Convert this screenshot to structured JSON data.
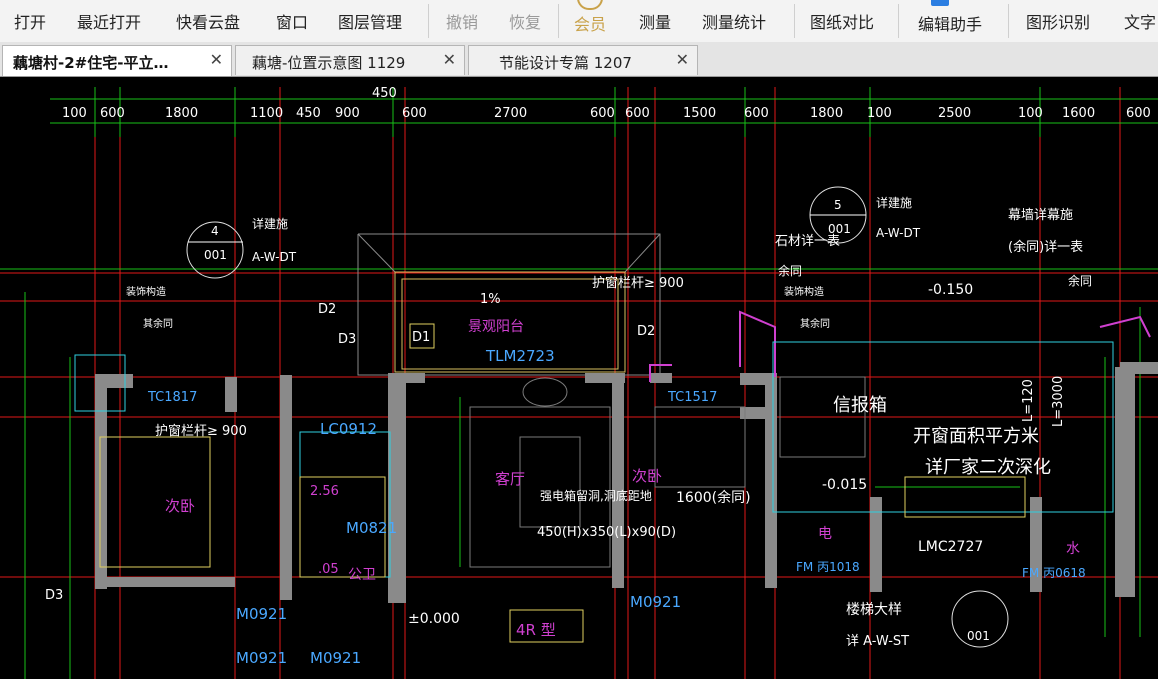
{
  "toolbar": {
    "items": [
      {
        "label": "打开",
        "state": "enabled"
      },
      {
        "label": "最近打开",
        "state": "enabled"
      },
      {
        "label": "快看云盘",
        "state": "enabled"
      },
      {
        "label": "窗口",
        "state": "enabled"
      },
      {
        "label": "图层管理",
        "state": "enabled"
      },
      {
        "label": "撤销",
        "state": "disabled"
      },
      {
        "label": "恢复",
        "state": "disabled"
      },
      {
        "label": "会员",
        "state": "vip"
      },
      {
        "label": "测量",
        "state": "enabled"
      },
      {
        "label": "测量统计",
        "state": "enabled"
      },
      {
        "label": "图纸对比",
        "state": "enabled"
      },
      {
        "label": "编辑助手",
        "state": "enabled"
      },
      {
        "label": "图形识别",
        "state": "enabled"
      },
      {
        "label": "文字",
        "state": "enabled"
      }
    ]
  },
  "tabs": [
    {
      "label": "藕塘村-2#住宅-平立…",
      "active": true,
      "close": "✕"
    },
    {
      "label": "藕塘-位置示意图 1129",
      "active": false,
      "close": "✕"
    },
    {
      "label": "节能设计专篇 1207",
      "active": false,
      "close": "✕"
    }
  ],
  "drawing": {
    "top_dim_labels": [
      "100",
      "600",
      "1800",
      "1100",
      "450",
      "900",
      "600",
      "2700",
      "600",
      "600",
      "1500",
      "600",
      "1800",
      "100",
      "2500",
      "100",
      "1600",
      "600"
    ],
    "overall_dim": "450",
    "detail_callouts": [
      {
        "number": "4",
        "sheet": "001",
        "note": "详建施",
        "ref": "A-W-DT"
      },
      {
        "number": "5",
        "sheet": "001",
        "note": "详建施",
        "ref": "A-W-DT"
      }
    ],
    "labels": {
      "balcony": "景观阳台",
      "slope": "1%",
      "tlm": "TLM2723",
      "railing1": "护窗栏杆≥ 900",
      "railing2": "护窗栏杆≥ 900",
      "d1": "D1",
      "d2a": "D2",
      "d2b": "D2",
      "d3a": "D3",
      "d3b": "D3",
      "tc1817": "TC1817",
      "tc1517": "TC1517",
      "lc0912": "LC0912",
      "living": "客厅",
      "bedroom1": "次卧",
      "bedroom2": "次卧",
      "bath": "公卫",
      "elec_box_line1": "强电箱留洞,洞底距地",
      "elec_box_line2": "450(H)x350(L)x90(D)",
      "rest": "1600(余同)",
      "m0821": "M0821",
      "m0921a": "M0921",
      "m0921b": "M0921",
      "m0921c": "M0921",
      "m0921d": "M0921",
      "elevation0": "±0.000",
      "type4r": "4R 型",
      "info_box": "信报箱",
      "window_area_line1": "开窗面积平方米",
      "window_area_line2": "详厂家二次深化",
      "elev_neg015a": "-0.150",
      "elev_neg015b": "-0.015",
      "lmc": "LMC2727",
      "elec": "电",
      "water": "水",
      "fm1018": "FM 丙1018",
      "fm0618": "FM 丙0618",
      "stair": "楼梯大样",
      "stair_ref": "详 A-W-ST",
      "callout6_sheet": "001",
      "stone": "石材详一表",
      "curtain1": "幕墙详幕施",
      "curtain2": "(余同)详一表",
      "same1": "余同",
      "same2": "余同",
      "deco1": "装饰构造",
      "deco2": "装饰构造",
      "same3": "其余同",
      "same4": "其余同",
      "l3000": "L=3000",
      "l120": "L=120",
      "pct256": "2.56",
      "pct05": ".05"
    }
  },
  "colors": {
    "grid_red": "#e01818",
    "dim_green": "#18c018",
    "wall_gray": "#9a9a9a",
    "text_white": "#ffffff",
    "text_cyan": "#4aa8ff",
    "text_magenta": "#d040d0",
    "text_yellow": "#e8e060",
    "text_orange": "#e08a30"
  }
}
